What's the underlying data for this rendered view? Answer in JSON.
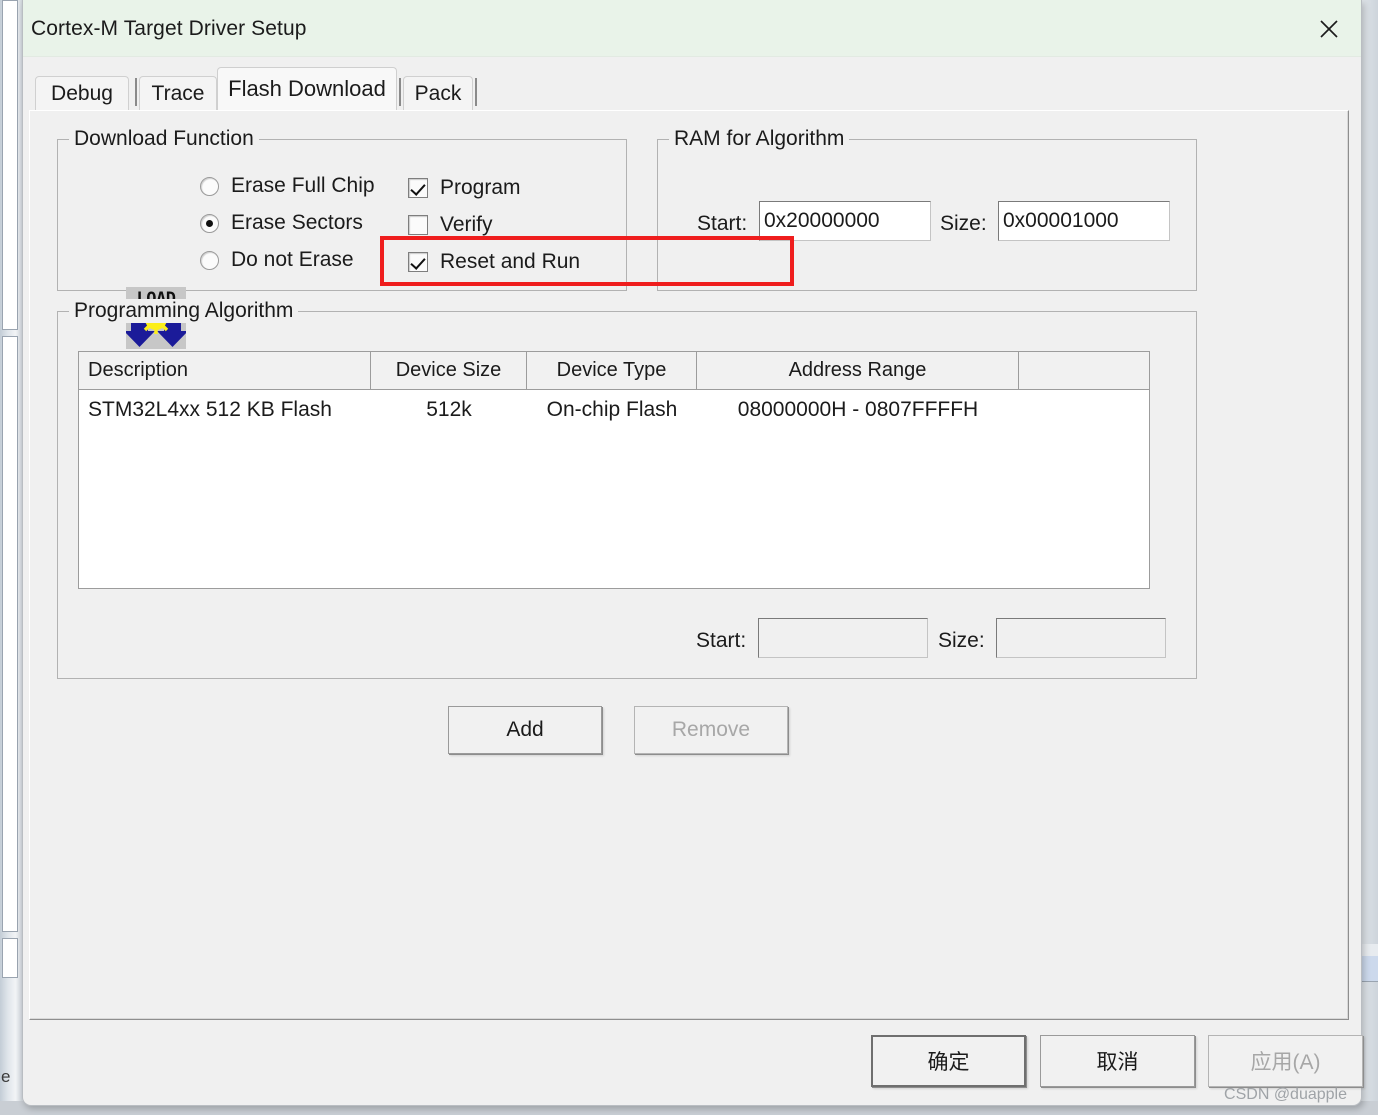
{
  "window": {
    "title": "Cortex-M Target Driver Setup",
    "close_icon": "close-icon",
    "titlebar_color": "#e9f3e9"
  },
  "tabs": [
    {
      "label": "Debug",
      "active": false
    },
    {
      "label": "Trace",
      "active": false
    },
    {
      "label": "Flash Download",
      "active": true
    },
    {
      "label": "Pack",
      "active": false
    }
  ],
  "download_function": {
    "title": "Download Function",
    "icon": {
      "name": "load-icon",
      "text": "LOAD"
    },
    "erase_options": [
      {
        "label": "Erase Full Chip",
        "checked": false
      },
      {
        "label": "Erase Sectors",
        "checked": true
      },
      {
        "label": "Do not Erase",
        "checked": false
      }
    ],
    "action_options": [
      {
        "label": "Program",
        "checked": true
      },
      {
        "label": "Verify",
        "checked": false
      },
      {
        "label": "Reset and Run",
        "checked": true
      }
    ]
  },
  "ram_for_algorithm": {
    "title": "RAM for Algorithm",
    "start_label": "Start:",
    "start_value": "0x20000000",
    "size_label": "Size:",
    "size_value": "0x00001000"
  },
  "programming_algorithm": {
    "title": "Programming Algorithm",
    "columns": [
      "Description",
      "Device Size",
      "Device Type",
      "Address Range",
      ""
    ],
    "rows": [
      {
        "description": "STM32L4xx 512 KB Flash",
        "device_size": "512k",
        "device_type": "On-chip Flash",
        "address_range": "08000000H - 0807FFFFH",
        "extra": ""
      }
    ],
    "start_label": "Start:",
    "start_value": "",
    "size_label": "Size:",
    "size_value": "",
    "add_button": "Add",
    "remove_button": "Remove",
    "remove_enabled": false
  },
  "footer": {
    "ok_button": "确定",
    "cancel_button": "取消",
    "apply_button": "应用(A)",
    "apply_enabled": false
  },
  "watermark": "CSDN @duapple",
  "highlight": {
    "color": "#ef1d1d",
    "target": "Reset and Run"
  }
}
